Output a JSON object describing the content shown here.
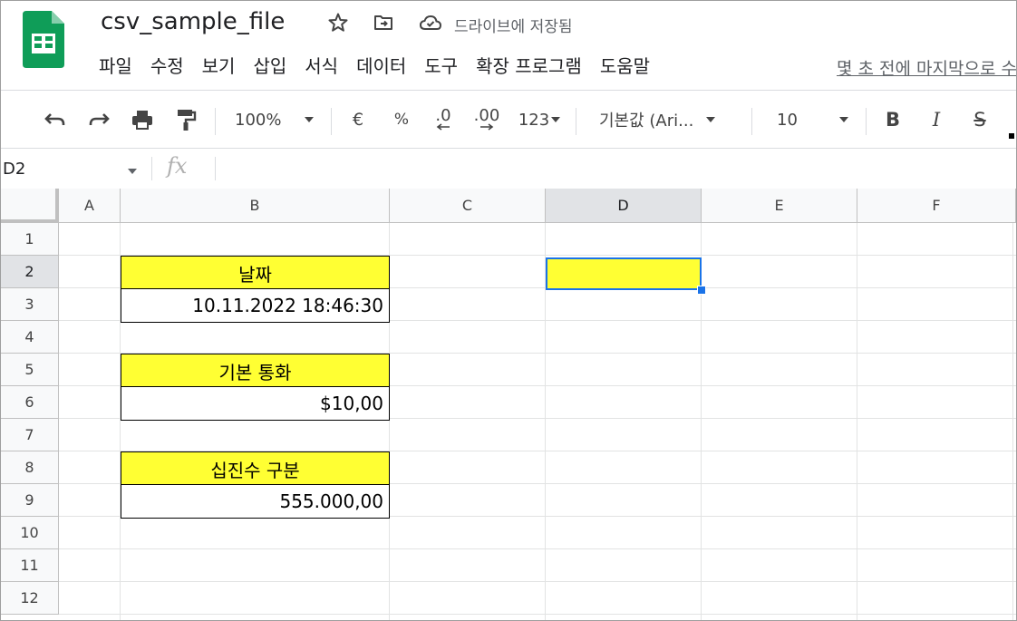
{
  "header": {
    "doc_title": "csv_sample_file",
    "save_status": "드라이브에 저장됨",
    "last_edit": "몇 초 전에 마지막으로 수정"
  },
  "menu": [
    "파일",
    "수정",
    "보기",
    "삽입",
    "서식",
    "데이터",
    "도구",
    "확장 프로그램",
    "도움말"
  ],
  "toolbar": {
    "zoom": "100%",
    "currency": "€",
    "percent": "%",
    "decrease_decimal": ".0",
    "increase_decimal": ".00",
    "more_formats": "123",
    "font": "기본값 (Ari...",
    "font_size": "10",
    "bold": "B",
    "italic": "I",
    "strike": "S"
  },
  "formula_bar": {
    "name_box": "D2",
    "fx": "fx",
    "content": ""
  },
  "grid": {
    "columns": [
      "A",
      "B",
      "C",
      "D",
      "E",
      "F"
    ],
    "rows": [
      "1",
      "2",
      "3",
      "4",
      "5",
      "6",
      "7",
      "8",
      "9",
      "10",
      "11",
      "12"
    ],
    "active_column": "D",
    "active_row": "2",
    "cells": {
      "B2": "날짜",
      "B3": "10.11.2022 18:46:30",
      "B5": "기본 통화",
      "B6": "$10,00",
      "B8": "십진수 구분",
      "B9": "555.000,00",
      "D2": ""
    }
  },
  "colors": {
    "header_fill": "#ffff33",
    "selection": "#1a73e8",
    "sheets_green": "#0f9d58"
  },
  "icons": [
    "sheets-logo-icon",
    "star-icon",
    "move-to-folder-icon",
    "cloud-saved-icon",
    "undo-icon",
    "redo-icon",
    "print-icon",
    "paint-format-icon"
  ]
}
